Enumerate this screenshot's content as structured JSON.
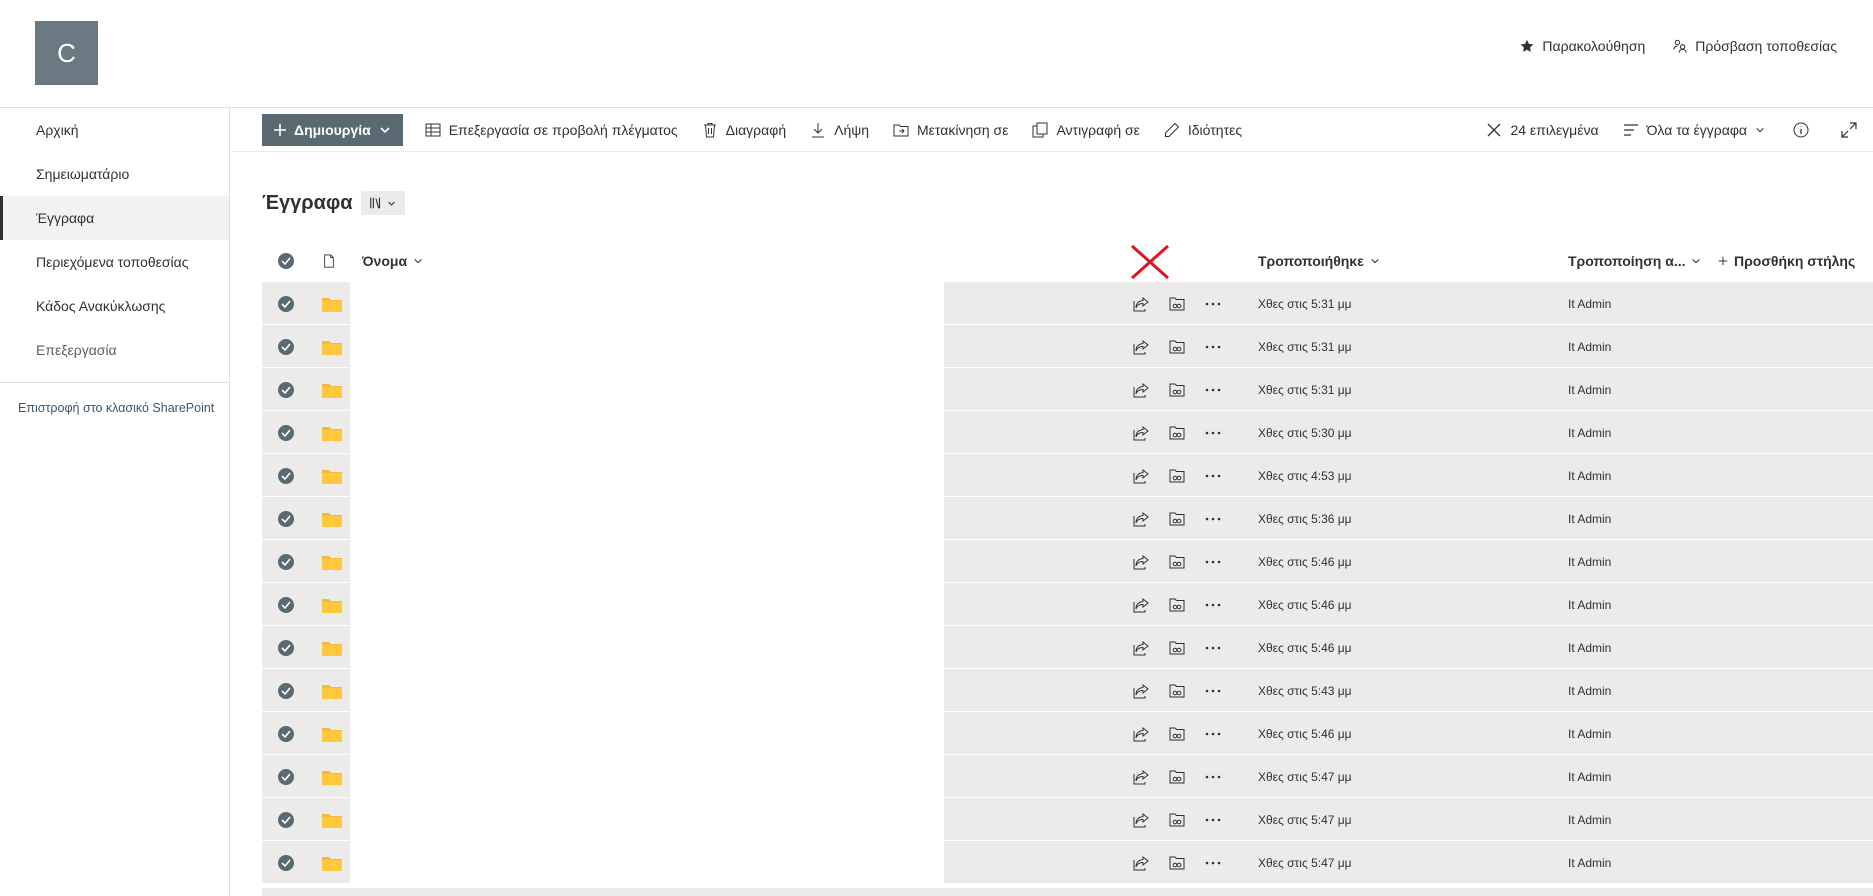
{
  "site": {
    "logo_letter": "C"
  },
  "header": {
    "follow": "Παρακολούθηση",
    "site_access": "Πρόσβαση τοποθεσίας"
  },
  "nav": {
    "items": [
      "Αρχική",
      "Σημειωματάριο",
      "Έγγραφα",
      "Περιεχόμενα τοποθεσίας",
      "Κάδος Ανακύκλωσης"
    ],
    "selected_index": 2,
    "edit": "Επεξεργασία",
    "classic": "Επιστροφή στο κλασικό SharePoint"
  },
  "commands": {
    "new": "Δημιουργία",
    "grid_edit": "Επεξεργασία σε προβολή πλέγματος",
    "delete": "Διαγραφή",
    "download": "Λήψη",
    "move": "Μετακίνηση σε",
    "copy": "Αντιγραφή σε",
    "properties": "Ιδιότητες",
    "selected": "24 επιλεγμένα",
    "view": "Όλα τα έγγραφα"
  },
  "library": {
    "title": "Έγγραφα"
  },
  "columns": {
    "name": "Όνομα",
    "modified": "Τροποποιήθηκε",
    "modified_by": "Τροποποίηση α...",
    "add_column": "Προσθήκη στήλης"
  },
  "rows": [
    {
      "modified": "Χθες στις 5:31 μμ",
      "modified_by": "It Admin"
    },
    {
      "modified": "Χθες στις 5:31 μμ",
      "modified_by": "It Admin"
    },
    {
      "modified": "Χθες στις 5:31 μμ",
      "modified_by": "It Admin"
    },
    {
      "modified": "Χθες στις 5:30 μμ",
      "modified_by": "It Admin"
    },
    {
      "modified": "Χθες στις 4:53 μμ",
      "modified_by": "It Admin"
    },
    {
      "modified": "Χθες στις 5:36 μμ",
      "modified_by": "It Admin"
    },
    {
      "modified": "Χθες στις 5:46 μμ",
      "modified_by": "It Admin"
    },
    {
      "modified": "Χθες στις 5:46 μμ",
      "modified_by": "It Admin"
    },
    {
      "modified": "Χθες στις 5:46 μμ",
      "modified_by": "It Admin"
    },
    {
      "modified": "Χθες στις 5:43 μμ",
      "modified_by": "It Admin"
    },
    {
      "modified": "Χθες στις 5:46 μμ",
      "modified_by": "It Admin"
    },
    {
      "modified": "Χθες στις 5:47 μμ",
      "modified_by": "It Admin"
    },
    {
      "modified": "Χθες στις 5:47 μμ",
      "modified_by": "It Admin"
    },
    {
      "modified": "Χθες στις 5:47 μμ",
      "modified_by": "It Admin"
    }
  ],
  "icons": {
    "row": [
      "check-circle-icon",
      "folder-icon",
      "share-icon",
      "copy-link-icon",
      "more-icon"
    ],
    "folder_color": "#f4b93a",
    "check_color": "#5a6a72",
    "accent": "#5a6a72",
    "annotation_x_color": "#e0141e"
  }
}
